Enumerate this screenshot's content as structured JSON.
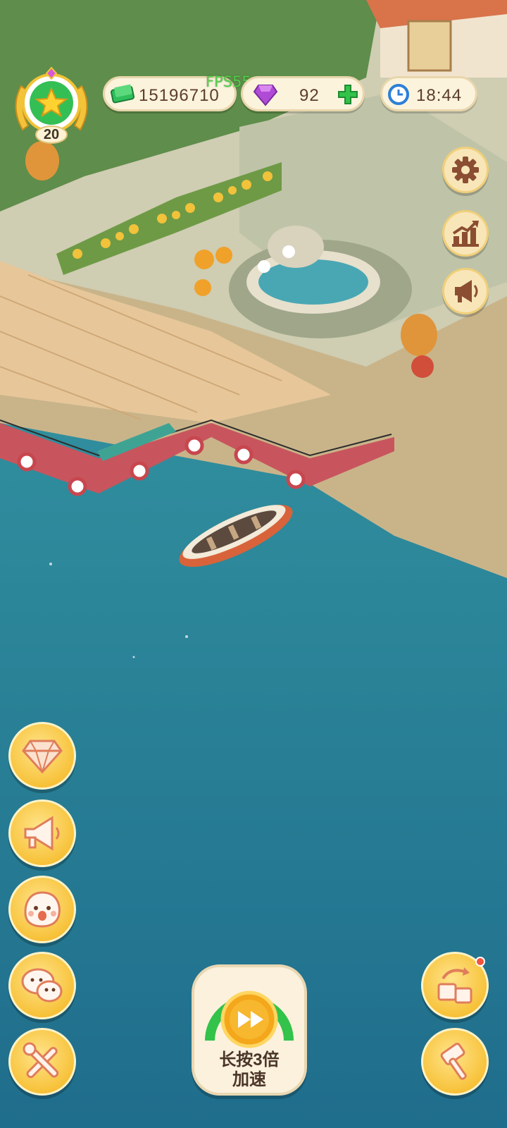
{
  "hud": {
    "level": "20",
    "cash": "15196710",
    "gems": "92",
    "clock": "18:44",
    "fps": "FPS55"
  },
  "right_menu": [
    {
      "name": "settings",
      "icon": "gear-icon"
    },
    {
      "name": "stats",
      "icon": "chart-icon"
    },
    {
      "name": "announcements",
      "icon": "megaphone-icon"
    }
  ],
  "left_menu": [
    {
      "name": "diamond-shop",
      "icon": "diamond-icon"
    },
    {
      "name": "promotion",
      "icon": "megaphone-icon"
    },
    {
      "name": "emote",
      "icon": "face-icon"
    },
    {
      "name": "chat",
      "icon": "chat-icon"
    },
    {
      "name": "tools",
      "icon": "tools-icon"
    }
  ],
  "speed_up": {
    "label": "长按3倍\n加速",
    "icon": "fast-forward-icon"
  },
  "bottom_right": [
    {
      "name": "gift-exchange",
      "icon": "gift-icon",
      "has_notification": true
    },
    {
      "name": "auction",
      "icon": "hammer-icon"
    }
  ],
  "colors": {
    "water": "#2a7f95",
    "grass": "#5c8a4a",
    "dock": "#e9c99a",
    "cash_green": "#2fbf5b",
    "gem_purple": "#b04bd6",
    "hud_bg": "#fbf3dc",
    "button_yellow": "#f7c23a"
  }
}
